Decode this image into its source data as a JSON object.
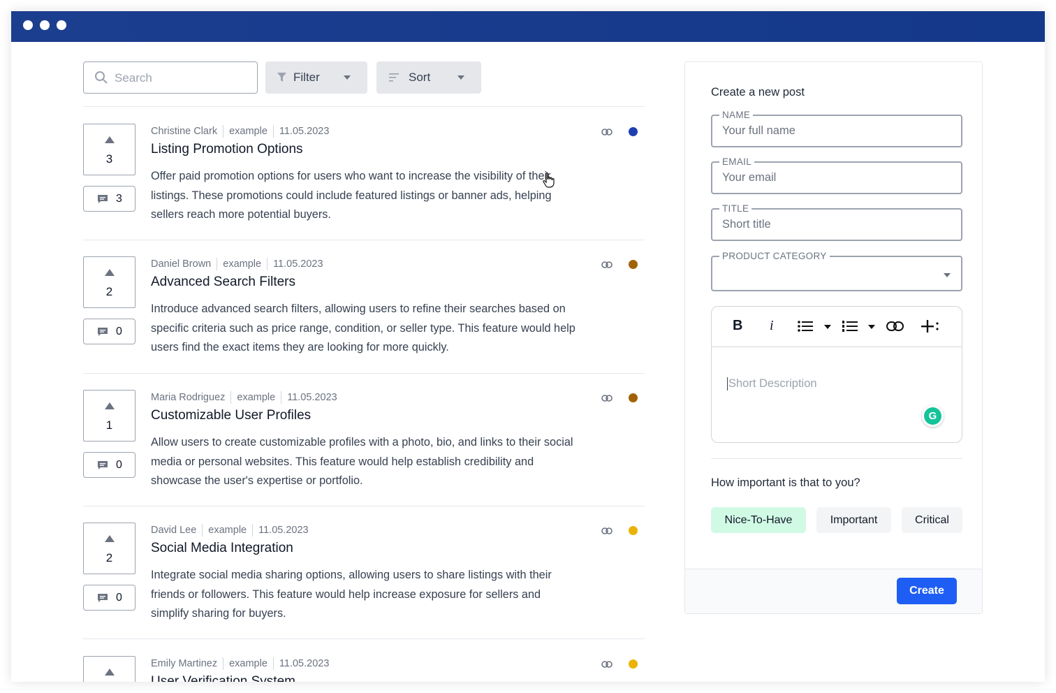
{
  "colors": {
    "titlebar": "#14388a",
    "accent": "#1f5ef5",
    "chip_selected": "#d1fae5",
    "chip_default": "#f3f4f6"
  },
  "toolbar": {
    "search_placeholder": "Search",
    "filter_label": "Filter",
    "sort_label": "Sort"
  },
  "posts": [
    {
      "votes": "3",
      "comments": "3",
      "author": "Christine Clark",
      "category": "example",
      "date": "11.05.2023",
      "title": "Listing Promotion Options",
      "description": "Offer paid promotion options for users who want to increase the visibility of their listings. These promotions could include featured listings or banner ads, helping sellers reach more potential buyers.",
      "status_color": "#1e40af"
    },
    {
      "votes": "2",
      "comments": "0",
      "author": "Daniel Brown",
      "category": "example",
      "date": "11.05.2023",
      "title": "Advanced Search Filters",
      "description": "Introduce advanced search filters, allowing users to refine their searches based on specific criteria such as price range, condition, or seller type. This feature would help users find the exact items they are looking for more quickly.",
      "status_color": "#a16207"
    },
    {
      "votes": "1",
      "comments": "0",
      "author": "Maria Rodriguez",
      "category": "example",
      "date": "11.05.2023",
      "title": "Customizable User Profiles",
      "description": "Allow users to create customizable profiles with a photo, bio, and links to their social media or personal websites. This feature would help establish credibility and showcase the user's expertise or portfolio.",
      "status_color": "#a16207"
    },
    {
      "votes": "2",
      "comments": "0",
      "author": "David Lee",
      "category": "example",
      "date": "11.05.2023",
      "title": "Social Media Integration",
      "description": "Integrate social media sharing options, allowing users to share listings with their friends or followers. This feature would help increase exposure for sellers and simplify sharing for buyers.",
      "status_color": "#eab308"
    },
    {
      "votes": "",
      "comments": "",
      "author": "Emily Martinez",
      "category": "example",
      "date": "11.05.2023",
      "title": "User Verification System",
      "description": "",
      "status_color": "#eab308"
    }
  ],
  "form": {
    "title": "Create a new post",
    "name_label": "NAME",
    "name_placeholder": "Your full name",
    "email_label": "EMAIL",
    "email_placeholder": "Your email",
    "title_label": "TITLE",
    "title_placeholder": "Short title",
    "category_label": "PRODUCT CATEGORY",
    "description_placeholder": "Short Description",
    "importance_question": "How important is that to you?",
    "chips": [
      "Nice-To-Have",
      "Important",
      "Critical"
    ],
    "create_label": "Create",
    "grammarly": "G"
  }
}
